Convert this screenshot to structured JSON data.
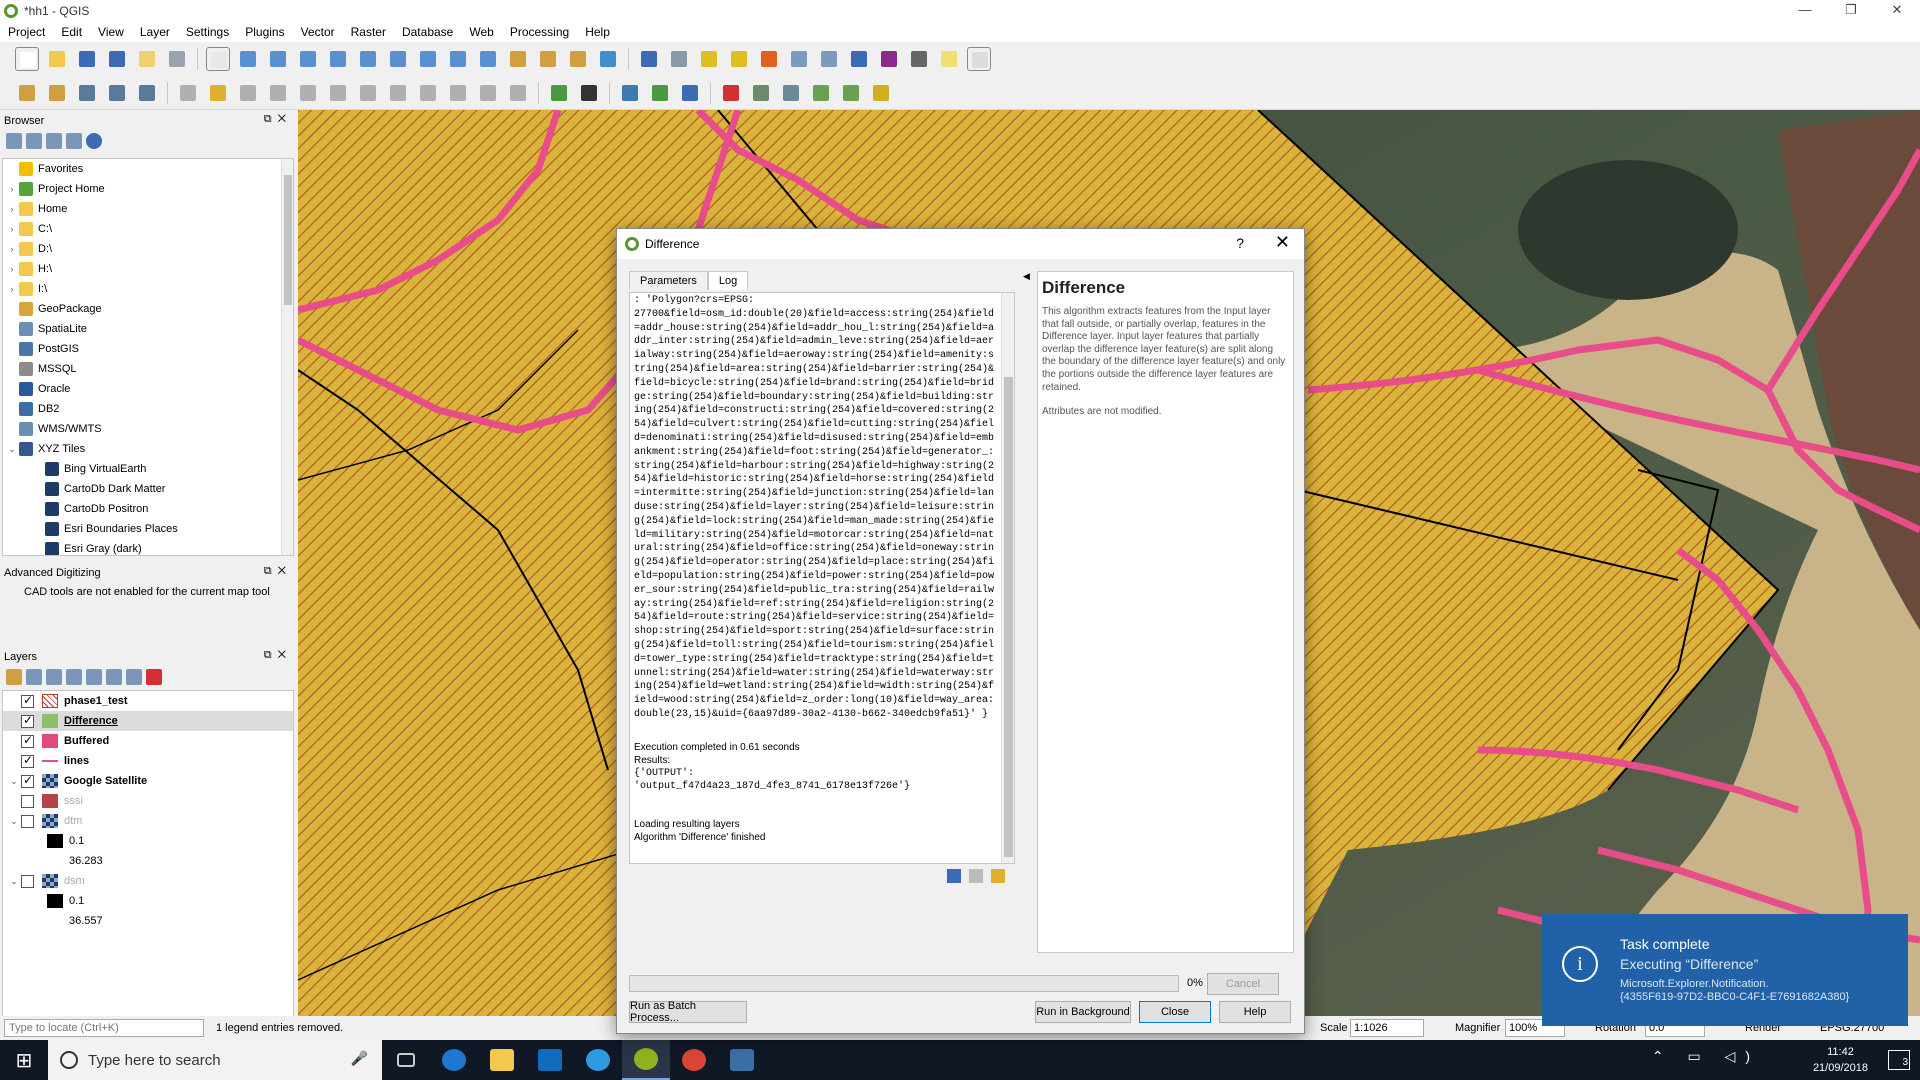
{
  "window": {
    "title": "*hh1 - QGIS"
  },
  "menu": [
    "Project",
    "Edit",
    "View",
    "Layer",
    "Settings",
    "Plugins",
    "Vector",
    "Raster",
    "Database",
    "Web",
    "Processing",
    "Help"
  ],
  "browser": {
    "title": "Browser",
    "items": [
      {
        "label": "Favorites",
        "icon": "star-icon",
        "arrow": "",
        "indent": 0,
        "color": "#f0c000"
      },
      {
        "label": "Project Home",
        "icon": "project-home-icon",
        "arrow": "›",
        "indent": 0,
        "color": "#58a23a"
      },
      {
        "label": "Home",
        "icon": "folder-icon",
        "arrow": "›",
        "indent": 0,
        "color": "#f2c94c"
      },
      {
        "label": "C:\\",
        "icon": "folder-icon",
        "arrow": "›",
        "indent": 0,
        "color": "#f2c94c"
      },
      {
        "label": "D:\\",
        "icon": "folder-icon",
        "arrow": "›",
        "indent": 0,
        "color": "#f2c94c"
      },
      {
        "label": "H:\\",
        "icon": "folder-icon",
        "arrow": "›",
        "indent": 0,
        "color": "#f2c94c"
      },
      {
        "label": "I:\\",
        "icon": "folder-icon",
        "arrow": "›",
        "indent": 0,
        "color": "#f2c94c"
      },
      {
        "label": "GeoPackage",
        "icon": "geopackage-icon",
        "arrow": "",
        "indent": 0,
        "color": "#d8a63a"
      },
      {
        "label": "SpatiaLite",
        "icon": "spatialite-icon",
        "arrow": "",
        "indent": 0,
        "color": "#6d8fb5"
      },
      {
        "label": "PostGIS",
        "icon": "postgis-icon",
        "arrow": "",
        "indent": 0,
        "color": "#4a76a8"
      },
      {
        "label": "MSSQL",
        "icon": "mssql-icon",
        "arrow": "",
        "indent": 0,
        "color": "#8c8c8c"
      },
      {
        "label": "Oracle",
        "icon": "oracle-icon",
        "arrow": "",
        "indent": 0,
        "color": "#2a5a9a"
      },
      {
        "label": "DB2",
        "icon": "db2-icon",
        "arrow": "",
        "indent": 0,
        "color": "#3b6ea5"
      },
      {
        "label": "WMS/WMTS",
        "icon": "wms-icon",
        "arrow": "",
        "indent": 0,
        "color": "#6a8db4"
      },
      {
        "label": "XYZ Tiles",
        "icon": "xyz-tiles-icon",
        "arrow": "⌄",
        "indent": 0,
        "color": "#35598a"
      },
      {
        "label": "Bing VirtualEarth",
        "icon": "tile-icon",
        "arrow": "",
        "indent": 1,
        "color": "#1d3b66"
      },
      {
        "label": "CartoDb Dark Matter",
        "icon": "tile-icon",
        "arrow": "",
        "indent": 1,
        "color": "#1d3b66"
      },
      {
        "label": "CartoDb Positron",
        "icon": "tile-icon",
        "arrow": "",
        "indent": 1,
        "color": "#1d3b66"
      },
      {
        "label": "Esri Boundaries Places",
        "icon": "tile-icon",
        "arrow": "",
        "indent": 1,
        "color": "#1d3b66"
      },
      {
        "label": "Esri Gray (dark)",
        "icon": "tile-icon",
        "arrow": "",
        "indent": 1,
        "color": "#1d3b66"
      }
    ]
  },
  "adv_digitizing": {
    "title": "Advanced Digitizing",
    "message": "CAD tools are not enabled for the current map tool"
  },
  "layers": {
    "title": "Layers",
    "items": [
      {
        "label": "phase1_test",
        "checked": true,
        "arrow": "",
        "bold": true,
        "greyed": false,
        "selected": false,
        "swatch": "hatch-red"
      },
      {
        "label": "Difference",
        "checked": true,
        "arrow": "",
        "bold": true,
        "greyed": false,
        "selected": true,
        "swatch": "#8fbf6a"
      },
      {
        "label": "Buffered",
        "checked": true,
        "arrow": "",
        "bold": true,
        "greyed": false,
        "selected": false,
        "swatch": "#e34a7a"
      },
      {
        "label": "lines",
        "checked": true,
        "arrow": "",
        "bold": true,
        "greyed": false,
        "selected": false,
        "swatch": "line"
      },
      {
        "label": "Google Satellite",
        "checked": true,
        "arrow": "⌄",
        "bold": true,
        "greyed": false,
        "selected": false,
        "swatch": "raster"
      },
      {
        "label": "sssi",
        "checked": false,
        "arrow": "",
        "bold": false,
        "greyed": true,
        "selected": false,
        "swatch": "#b7424b"
      },
      {
        "label": "dtm",
        "checked": false,
        "arrow": "⌄",
        "bold": false,
        "greyed": true,
        "selected": false,
        "swatch": "raster"
      },
      {
        "label": "0.1",
        "checked": null,
        "arrow": "",
        "bold": false,
        "greyed": false,
        "selected": false,
        "swatch": "#000000",
        "indent": 2
      },
      {
        "label": "36.283",
        "checked": null,
        "arrow": "",
        "bold": false,
        "greyed": false,
        "selected": false,
        "swatch": "none",
        "indent": 2
      },
      {
        "label": "dsm",
        "checked": false,
        "arrow": "⌄",
        "bold": false,
        "greyed": true,
        "selected": false,
        "swatch": "raster"
      },
      {
        "label": "0.1",
        "checked": null,
        "arrow": "",
        "bold": false,
        "greyed": false,
        "selected": false,
        "swatch": "#000000",
        "indent": 2
      },
      {
        "label": "36.557",
        "checked": null,
        "arrow": "",
        "bold": false,
        "greyed": false,
        "selected": false,
        "swatch": "none",
        "indent": 2
      }
    ]
  },
  "status": {
    "locate_placeholder": "Type to locate (Ctrl+K)",
    "message": "1 legend entries removed.",
    "scale_label": "Scale",
    "scale_value": "1:1026",
    "magnifier_label": "Magnifier",
    "magnifier_value": "100%",
    "rotation_label": "Rotation",
    "rotation_value": "0.0",
    "render_label": "Render",
    "crs": "EPSG:27700"
  },
  "dialog": {
    "title": "Difference",
    "help_button": "?",
    "tabs": [
      "Parameters",
      "Log"
    ],
    "active_tab": "Log",
    "log_text": ": 'Polygon?crs=EPSG:\n27700&field=osm_id:double(20)&field=access:string(254)&field=addr_house:string(254)&field=addr_hou_l:string(254)&field=addr_inter:string(254)&field=admin_leve:string(254)&field=aerialway:string(254)&field=aeroway:string(254)&field=amenity:string(254)&field=area:string(254)&field=barrier:string(254)&field=bicycle:string(254)&field=brand:string(254)&field=bridge:string(254)&field=boundary:string(254)&field=building:string(254)&field=constructi:string(254)&field=covered:string(254)&field=culvert:string(254)&field=cutting:string(254)&field=denominati:string(254)&field=disused:string(254)&field=embankment:string(254)&field=foot:string(254)&field=generator_:string(254)&field=harbour:string(254)&field=highway:string(254)&field=historic:string(254)&field=horse:string(254)&field=intermitte:string(254)&field=junction:string(254)&field=landuse:string(254)&field=layer:string(254)&field=leisure:string(254)&field=lock:string(254)&field=man_made:string(254)&field=military:string(254)&field=motorcar:string(254)&field=natural:string(254)&field=office:string(254)&field=oneway:string(254)&field=operator:string(254)&field=place:string(254)&field=population:string(254)&field=power:string(254)&field=power_sour:string(254)&field=public_tra:string(254)&field=railway:string(254)&field=ref:string(254)&field=religion:string(254)&field=route:string(254)&field=service:string(254)&field=shop:string(254)&field=sport:string(254)&field=surface:string(254)&field=toll:string(254)&field=tourism:string(254)&field=tower_type:string(254)&field=tracktype:string(254)&field=tunnel:string(254)&field=water:string(254)&field=waterway:string(254)&field=wetland:string(254)&field=width:string(254)&field=wood:string(254)&field=z_order:long(10)&field=way_area:double(23,15)&uid={6aa97d89-30a2-4130-b662-340edcb9fa51}' }",
    "log_results": "Execution completed in 0.61 seconds\nResults:",
    "log_output": "{'OUTPUT':\n'output_f47d4a23_187d_4fe3_8741_6178e13f726e'}",
    "log_tail": "Loading resulting layers\nAlgorithm 'Difference' finished",
    "help_title": "Difference",
    "help_p1": "This algorithm extracts features from the Input layer that fall outside, or partially overlap, features in the Difference layer. Input layer features that partially overlap the difference layer feature(s) are split along the boundary of the difference layer feature(s) and only the portions outside the difference layer features are retained.",
    "help_p2": "Attributes are not modified.",
    "progress_percent": 0,
    "progress_label": "0%",
    "cancel": "Cancel",
    "batch": "Run as Batch Process...",
    "background": "Run in Background",
    "close": "Close",
    "help": "Help"
  },
  "notification": {
    "title": "Task complete",
    "line2": "Executing “Difference”",
    "line3": "Microsoft.Explorer.Notification.\n{4355F619-97D2-BBC0-C4F1-E7691682A380}"
  },
  "taskbar": {
    "search_placeholder": "Type here to search",
    "time": "11:42",
    "date": "21/09/2018",
    "notif_count": "3"
  },
  "colors": {
    "hatch_yellow": "#d9b43a",
    "hatch_red": "#c0392b",
    "road_pink": "#e84d8a",
    "qgis_green": "#589632",
    "notif_blue": "#2161a8"
  }
}
